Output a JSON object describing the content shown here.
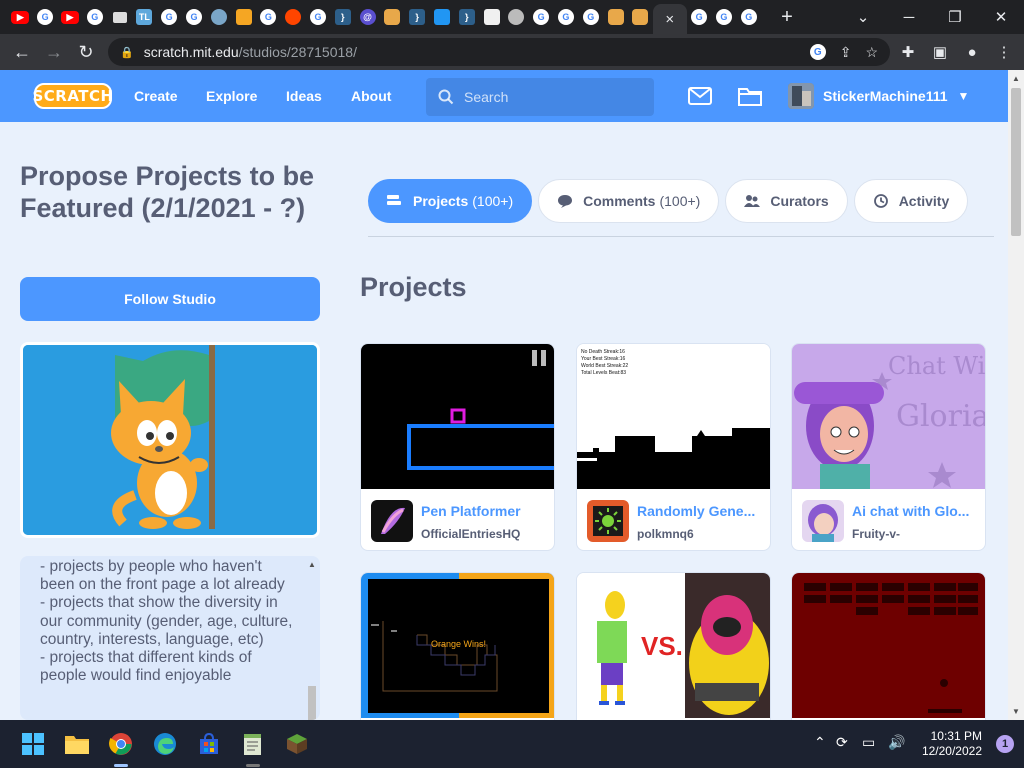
{
  "browser": {
    "active_tab_close": "×",
    "new_tab": "+",
    "url_host": "scratch.mit.edu",
    "url_path": "/studios/28715018/"
  },
  "site": {
    "logo_text": "SCRATCH",
    "nav": {
      "create": "Create",
      "explore": "Explore",
      "ideas": "Ideas",
      "about": "About"
    },
    "search_placeholder": "Search",
    "username": "StickerMachine111",
    "brand_color": "#4c97ff"
  },
  "studio": {
    "title": "Propose Projects to be Featured (2/1/2021 - ?)",
    "follow_label": "Follow Studio",
    "description": "- projects by people who haven't been on the front page a lot already\n- projects that show the diversity in our community (gender, age, culture, country, interests, language, etc)\n- projects that different kinds of people would find enjoyable",
    "tabs": [
      {
        "label": "Projects",
        "count": "(100+)",
        "icon": "projects-icon"
      },
      {
        "label": "Comments",
        "count": "(100+)",
        "icon": "comment-icon"
      },
      {
        "label": "Curators",
        "count": "",
        "icon": "curators-icon"
      },
      {
        "label": "Activity",
        "count": "",
        "icon": "activity-icon"
      }
    ],
    "section_title": "Projects",
    "projects": [
      {
        "title": "Pen Platformer",
        "author": "OfficialEntriesHQ"
      },
      {
        "title": "Randomly Gene...",
        "author": "polkmnq6"
      },
      {
        "title": "Ai chat with Glo...",
        "author": "Fruity-v-"
      },
      {
        "title": "",
        "author": ""
      },
      {
        "title": "",
        "author": ""
      },
      {
        "title": "",
        "author": ""
      }
    ],
    "thumb_texts": {
      "random_stats": [
        "No Death Streak:16",
        "Your Best Streak:16",
        "World Best Streak:22",
        "Total Levels Beat:83"
      ],
      "gloria_line1": "Chat With",
      "gloria_line2": "Gloria",
      "orange_wins": "Orange Wins!",
      "vs": "VS."
    }
  },
  "taskbar": {
    "time": "10:31 PM",
    "date": "12/20/2022",
    "notifications": "1"
  }
}
